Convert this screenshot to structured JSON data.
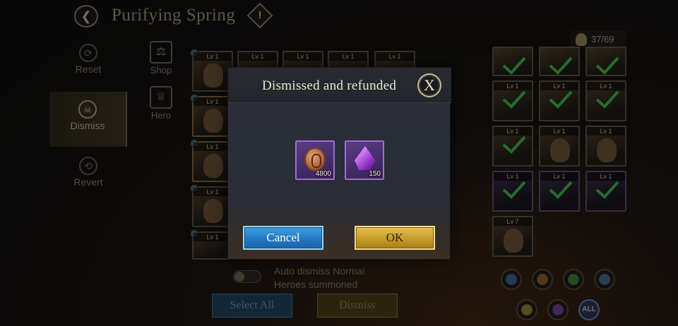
{
  "header": {
    "title": "Purifying Spring",
    "back_icon": "back-arrow-icon",
    "info_icon": "exclamation-icon",
    "info_glyph": "!"
  },
  "side_nav": [
    {
      "label": "Reset",
      "icon": "reset-icon",
      "active": false
    },
    {
      "label": "Dismiss",
      "icon": "dismiss-icon",
      "active": true
    },
    {
      "label": "Revert",
      "icon": "revert-icon",
      "active": false
    }
  ],
  "sub_nav": [
    {
      "label": "Shop",
      "icon": "scales-icon"
    },
    {
      "label": "Hero",
      "icon": "helmet-icon"
    }
  ],
  "hero_list": {
    "level_label": "Lv 1",
    "right_count": "37/69",
    "special_level": "Lv 7"
  },
  "auto_dismiss": {
    "label_line1": "Auto dismiss Normal",
    "label_line2": "Heroes summoned",
    "enabled": false
  },
  "bottom_buttons": {
    "select_all": "Select All",
    "dismiss": "Dismiss"
  },
  "faction_filter": {
    "all_label": "ALL"
  },
  "dialog": {
    "title": "Dismissed and refunded",
    "close_label": "X",
    "rewards": [
      {
        "item": "gold-coin-icon",
        "amount": "4800"
      },
      {
        "item": "purple-crystal-icon",
        "amount": "150"
      }
    ],
    "cancel_label": "Cancel",
    "ok_label": "OK"
  },
  "colors": {
    "cancel_blue": "#2478c1",
    "ok_gold": "#c79a2a",
    "reward_frame": "#9d6fd0",
    "dialog_bg": "#2b2f38"
  }
}
